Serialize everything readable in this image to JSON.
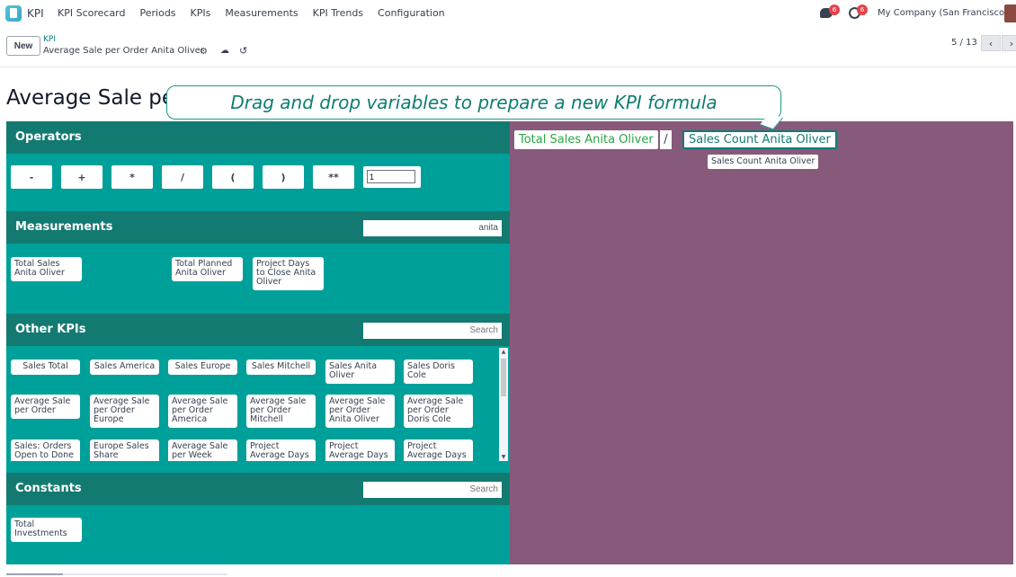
{
  "nav": {
    "app_name": "KPI",
    "menu": [
      "KPI Scorecard",
      "Periods",
      "KPIs",
      "Measurements",
      "KPI Trends",
      "Configuration"
    ],
    "messages_badge": "6",
    "activities_badge": "6",
    "company": "My Company (San Francisco)"
  },
  "control": {
    "new_label": "New",
    "breadcrumb_parent": "KPI",
    "breadcrumb_current": "Average Sale per Order Anita Oliver",
    "pager": "5 / 13"
  },
  "title": "Average Sale pe",
  "tooltip": "Drag and drop variables to prepare a new KPI formula",
  "operators": {
    "title": "Operators",
    "buttons": [
      "-",
      "+",
      "*",
      "/",
      "(",
      ")",
      "**"
    ],
    "input_value": "1"
  },
  "measurements": {
    "title": "Measurements",
    "search_value": "anita",
    "items": [
      "Total Sales Anita Oliver",
      "Total Planned Anita Oliver",
      "Project Days to Close Anita Oliver"
    ]
  },
  "other_kpis": {
    "title": "Other KPIs",
    "search_placeholder": "Search",
    "items": [
      "Sales Total",
      "Sales America",
      "Sales Europe",
      "Sales Mitchell",
      "Sales Anita Oliver",
      "Sales Doris Cole",
      "Average Sale per Order",
      "Average Sale per Order Europe",
      "Average Sale per Order America",
      "Average Sale per Order Mitchell",
      "Average Sale per Order Anita Oliver",
      "Average Sale per Order Doris Cole",
      "Sales: Orders Open to Done",
      "Europe Sales Share",
      "Average Sale per Week",
      "Project Average Days",
      "Project Average Days",
      "Project Average Days"
    ]
  },
  "constants": {
    "title": "Constants",
    "search_placeholder": "Search",
    "items": [
      "Total Investments"
    ]
  },
  "formula": {
    "left": "Total Sales Anita Oliver",
    "operator": "/",
    "right": "Sales Count Anita Oliver",
    "hover_tip": "Sales Count Anita Oliver"
  }
}
